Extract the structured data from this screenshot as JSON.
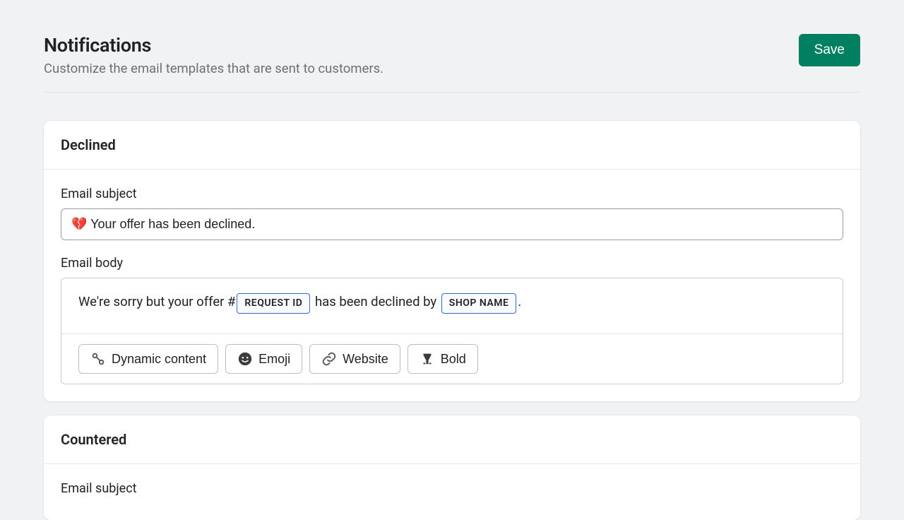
{
  "header": {
    "title": "Notifications",
    "subtitle": "Customize the email templates that are sent to customers.",
    "save_label": "Save"
  },
  "cards": {
    "declined": {
      "title": "Declined",
      "subject_label": "Email subject",
      "subject_value": "💔 Your offer has been declined.",
      "body_label": "Email body",
      "body_parts": {
        "before": "We're sorry but your offer #",
        "token1": "REQUEST ID",
        "middle": " has been declined by ",
        "token2": "SHOP NAME",
        "after": "."
      },
      "toolbar": {
        "dynamic": "Dynamic content",
        "emoji": "Emoji",
        "website": "Website",
        "bold": "Bold"
      }
    },
    "countered": {
      "title": "Countered",
      "subject_label": "Email subject"
    }
  }
}
